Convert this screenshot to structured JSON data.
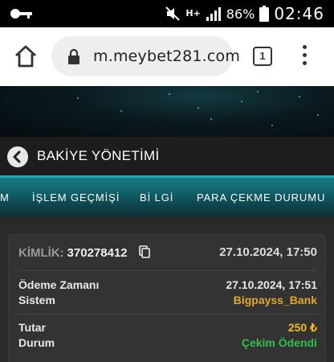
{
  "status_bar": {
    "battery": "86%",
    "time": "02:46",
    "network": "H+"
  },
  "browser": {
    "url": "m.meybet281.com",
    "tab_count": "1"
  },
  "page": {
    "title": "BAKİYE YÖNETİMİ"
  },
  "tabs": [
    {
      "label": "M"
    },
    {
      "label": "İŞLEM GEÇMİŞİ"
    },
    {
      "label": "Bİ LGİ"
    },
    {
      "label": "PARA ÇEKME DURUMU"
    }
  ],
  "transaction": {
    "id_label": "KİMLİK:",
    "id_value": "370278412",
    "created": "27.10.2024, 17:50",
    "payment_time_label": "Ödeme Zamanı",
    "payment_time_value": "27.10.2024, 17:51",
    "system_label": "Sistem",
    "system_value": "Bigpayss_Bank",
    "amount_label": "Tutar",
    "amount_value": "250 ₺",
    "status_label": "Durum",
    "status_value": "Çekim Ödendi"
  },
  "colors": {
    "accent_teal": "#1a7c86",
    "system_value": "#e2a82a",
    "amount_value": "#f3b81e",
    "status_value": "#2fc24a"
  }
}
